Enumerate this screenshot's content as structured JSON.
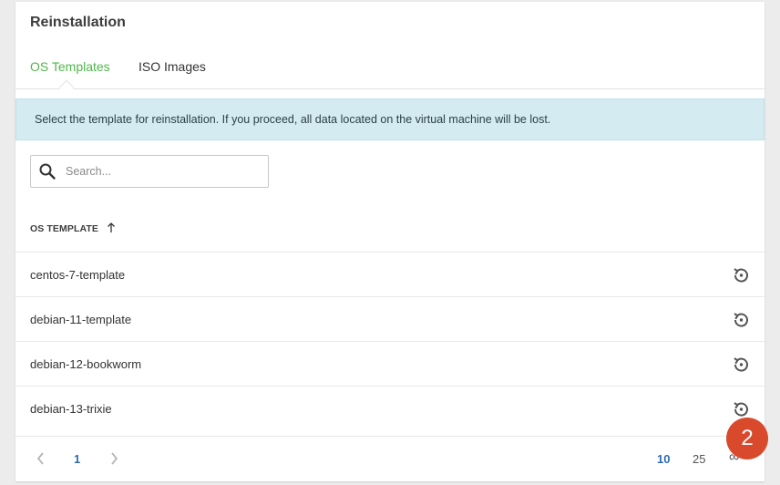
{
  "card": {
    "title": "Reinstallation"
  },
  "tabs": [
    {
      "label": "OS Templates",
      "active": true
    },
    {
      "label": "ISO Images",
      "active": false
    }
  ],
  "alert": {
    "text": "Select the template for reinstallation. If you proceed, all data located on the virtual machine will be lost."
  },
  "search": {
    "placeholder": "Search...",
    "value": ""
  },
  "table": {
    "column": "OS TEMPLATE",
    "sort": "ascending",
    "rows": [
      {
        "name": "centos-7-template"
      },
      {
        "name": "debian-11-template"
      },
      {
        "name": "debian-12-bookworm"
      },
      {
        "name": "debian-13-trixie"
      }
    ]
  },
  "pagination": {
    "current_page": "1",
    "per_page_options": [
      "10",
      "25",
      "∞"
    ],
    "selected_per_page": "10"
  },
  "badge": {
    "value": "2"
  },
  "colors": {
    "accent_green": "#4fb74a",
    "link_blue": "#2a6bb5",
    "alert_bg": "#d4ecf1",
    "badge_red": "#d94a2d"
  }
}
